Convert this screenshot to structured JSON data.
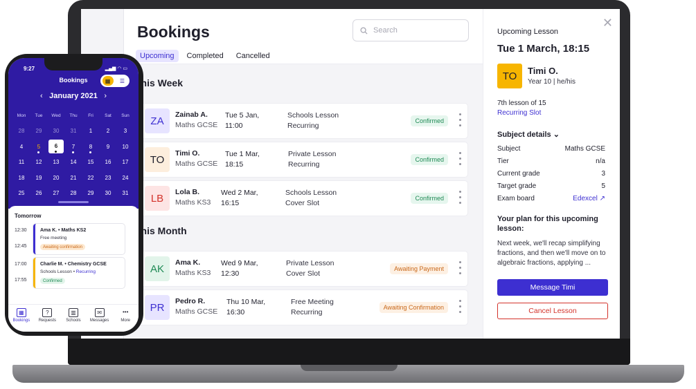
{
  "desktop": {
    "title": "Bookings",
    "search_placeholder": "Search",
    "tabs": [
      {
        "label": "Upcoming"
      },
      {
        "label": "Completed"
      },
      {
        "label": "Cancelled"
      }
    ],
    "sections": [
      {
        "title": "This Week"
      },
      {
        "title": "This Month"
      }
    ],
    "bookings": [
      {
        "initials": "ZA",
        "name": "Zainab A.",
        "subject": "Maths GCSE",
        "date1": "Tue 5 Jan,",
        "date2": "11:00",
        "type1": "Schools Lesson",
        "type2": "Recurring",
        "status": "Confirmed",
        "status_kind": "green",
        "avatar_bg": "#e7e4ff",
        "avatar_fg": "#3d2fd1"
      },
      {
        "initials": "TO",
        "name": "Timi O.",
        "subject": "Maths GCSE",
        "date1": "Tue 1 Mar,",
        "date2": "18:15",
        "type1": "Private Lesson",
        "type2": "Recurring",
        "status": "Confirmed",
        "status_kind": "green",
        "avatar_bg": "#fdeedd",
        "avatar_fg": "#1f1f2b"
      },
      {
        "initials": "LB",
        "name": "Lola B.",
        "subject": "Maths KS3",
        "date1": "Wed 2 Mar,",
        "date2": "16:15",
        "type1": "Schools Lesson",
        "type2": "Cover Slot",
        "status": "Confirmed",
        "status_kind": "green",
        "avatar_bg": "#fde4e4",
        "avatar_fg": "#d3322a"
      },
      {
        "initials": "AK",
        "name": "Ama K.",
        "subject": "Maths KS3",
        "date1": "Wed 9 Mar,",
        "date2": "12:30",
        "type1": "Private Lesson",
        "type2": "Cover Slot",
        "status": "Awaiting Payment",
        "status_kind": "orange",
        "avatar_bg": "#e2f4ea",
        "avatar_fg": "#1f8a55"
      },
      {
        "initials": "PR",
        "name": "Pedro R.",
        "subject": "Maths GCSE",
        "date1": "Thu 10 Mar,",
        "date2": "16:30",
        "type1": "Free Meeting",
        "type2": "Recurring",
        "status": "Awaiting Confirmation",
        "status_kind": "orange",
        "avatar_bg": "#e7e4ff",
        "avatar_fg": "#3d2fd1"
      }
    ]
  },
  "panel": {
    "label": "Upcoming Lesson",
    "date": "Tue 1 March,  18:15",
    "initials": "TO",
    "name": "Timi O.",
    "year": "Year 10 | he/his",
    "lesson_of": "7th lesson of 15",
    "recurring": "Recurring Slot",
    "subject_details": "Subject details",
    "details": [
      {
        "k": "Subject",
        "v": "Maths GCSE"
      },
      {
        "k": "Tier",
        "v": "n/a"
      },
      {
        "k": "Current grade",
        "v": "3"
      },
      {
        "k": "Target grade",
        "v": "5"
      },
      {
        "k": "Exam board",
        "v": "Edexcel ↗"
      }
    ],
    "plan_title": "Your plan for this upcoming lesson:",
    "plan_text": "Next week, we'll recap simplifying fractions, and then we'll move on to algebraic fractions, applying ...",
    "message_button": "Message Timi",
    "cancel_button": "Cancel Lesson",
    "close_icon": "close-icon"
  },
  "phone": {
    "time": "9:27",
    "status": "▂▄▆ ◠ ▭",
    "title": "Bookings",
    "month": "January 2021",
    "dow": [
      "Mon",
      "Tue",
      "Wed",
      "Thu",
      "Fri",
      "Sat",
      "Sun"
    ],
    "weeks": [
      [
        "28",
        "29",
        "30",
        "31",
        "1",
        "2",
        "3"
      ],
      [
        "4",
        "5",
        "6",
        "7",
        "8",
        "9",
        "10"
      ],
      [
        "11",
        "12",
        "13",
        "14",
        "15",
        "16",
        "17"
      ],
      [
        "18",
        "19",
        "20",
        "21",
        "22",
        "23",
        "24"
      ],
      [
        "25",
        "26",
        "27",
        "28",
        "29",
        "30",
        "31"
      ]
    ],
    "tomorrow": "Tomorrow",
    "events": [
      {
        "t1": "12:30",
        "t2": "12:45",
        "title": "Ama K. • Maths KS2",
        "sub": "Free meeting",
        "sub_link": "",
        "badge": "Awaiting confirmation",
        "kind": "orange",
        "bar": "purple"
      },
      {
        "t1": "17:00",
        "t2": "17:55",
        "title": "Charlie M. • Chemistry GCSE",
        "sub": "Schools Lesson • ",
        "sub_link": "Recurring",
        "badge": "Confirmed",
        "kind": "green",
        "bar": "yellow"
      }
    ],
    "nav": [
      {
        "label": "Bookings",
        "icon": "calendar-icon",
        "glyph": "▦"
      },
      {
        "label": "Requests",
        "icon": "question-icon",
        "glyph": "?"
      },
      {
        "label": "Schools",
        "icon": "building-icon",
        "glyph": "▥"
      },
      {
        "label": "Messages",
        "icon": "message-icon",
        "glyph": "✉"
      },
      {
        "label": "More",
        "icon": "more-icon",
        "glyph": "•••"
      }
    ]
  }
}
